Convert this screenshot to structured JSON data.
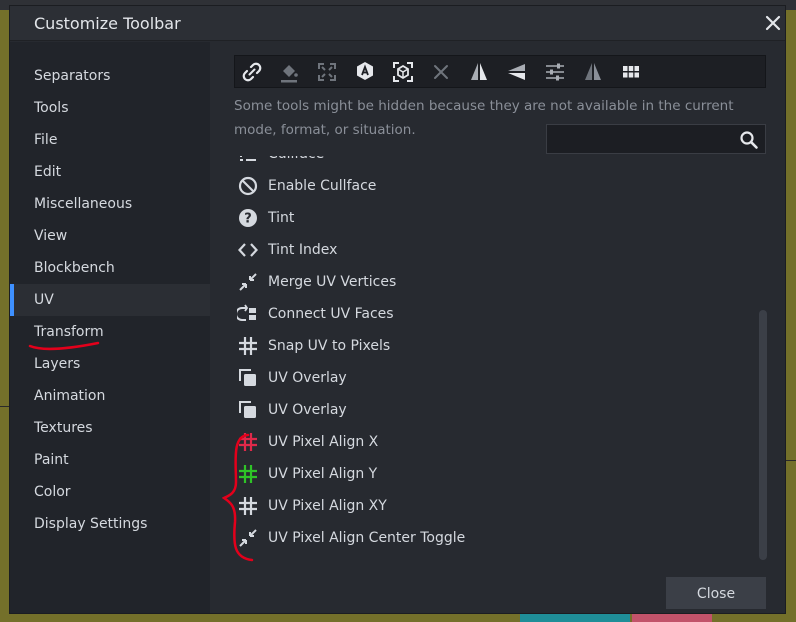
{
  "dialog": {
    "title": "Customize Toolbar"
  },
  "sidebar": {
    "items": [
      {
        "label": "Separators"
      },
      {
        "label": "Tools"
      },
      {
        "label": "File"
      },
      {
        "label": "Edit"
      },
      {
        "label": "Miscellaneous"
      },
      {
        "label": "View"
      },
      {
        "label": "Blockbench"
      },
      {
        "label": "UV",
        "active": true
      },
      {
        "label": "Transform"
      },
      {
        "label": "Layers"
      },
      {
        "label": "Animation"
      },
      {
        "label": "Textures"
      },
      {
        "label": "Paint"
      },
      {
        "label": "Color"
      },
      {
        "label": "Display Settings"
      }
    ]
  },
  "toolbar": {
    "icons": [
      "link-icon",
      "paint-bucket-icon",
      "fullscreen-icon",
      "auto-uv-icon",
      "cube-focus-icon",
      "clear-icon",
      "mirror-x-icon",
      "mirror-y-icon",
      "sliders-icon",
      "triangle-mirror-icon",
      "grid-icon"
    ]
  },
  "hint": {
    "text": "Some tools might be hidden because they are not available in the current mode, format, or situation."
  },
  "search": {
    "value": "",
    "placeholder": ""
  },
  "list": {
    "items": [
      {
        "label": "Cullface",
        "icon": "cullface-icon"
      },
      {
        "label": "Enable Cullface",
        "icon": "block-icon"
      },
      {
        "label": "Tint",
        "icon": "help-icon"
      },
      {
        "label": "Tint Index",
        "icon": "code-icon"
      },
      {
        "label": "Merge UV Vertices",
        "icon": "merge-icon"
      },
      {
        "label": "Connect UV Faces",
        "icon": "connect-icon"
      },
      {
        "label": "Snap UV to Pixels",
        "icon": "grid-hash-icon"
      },
      {
        "label": "UV Overlay",
        "icon": "overlay-icon"
      },
      {
        "label": "UV Overlay",
        "icon": "overlay-icon"
      },
      {
        "label": "UV Pixel Align X",
        "icon": "grid-hash-red-icon"
      },
      {
        "label": "UV Pixel Align Y",
        "icon": "grid-hash-green-icon"
      },
      {
        "label": "UV Pixel Align XY",
        "icon": "grid-hash-icon"
      },
      {
        "label": "UV Pixel Align Center Toggle",
        "icon": "merge-icon"
      }
    ]
  },
  "buttons": {
    "close": "Close"
  },
  "colors": {
    "accent": "#3e90ff",
    "annotation": "#e3001b",
    "align_x": "#e0294a",
    "align_y": "#2ec427"
  }
}
